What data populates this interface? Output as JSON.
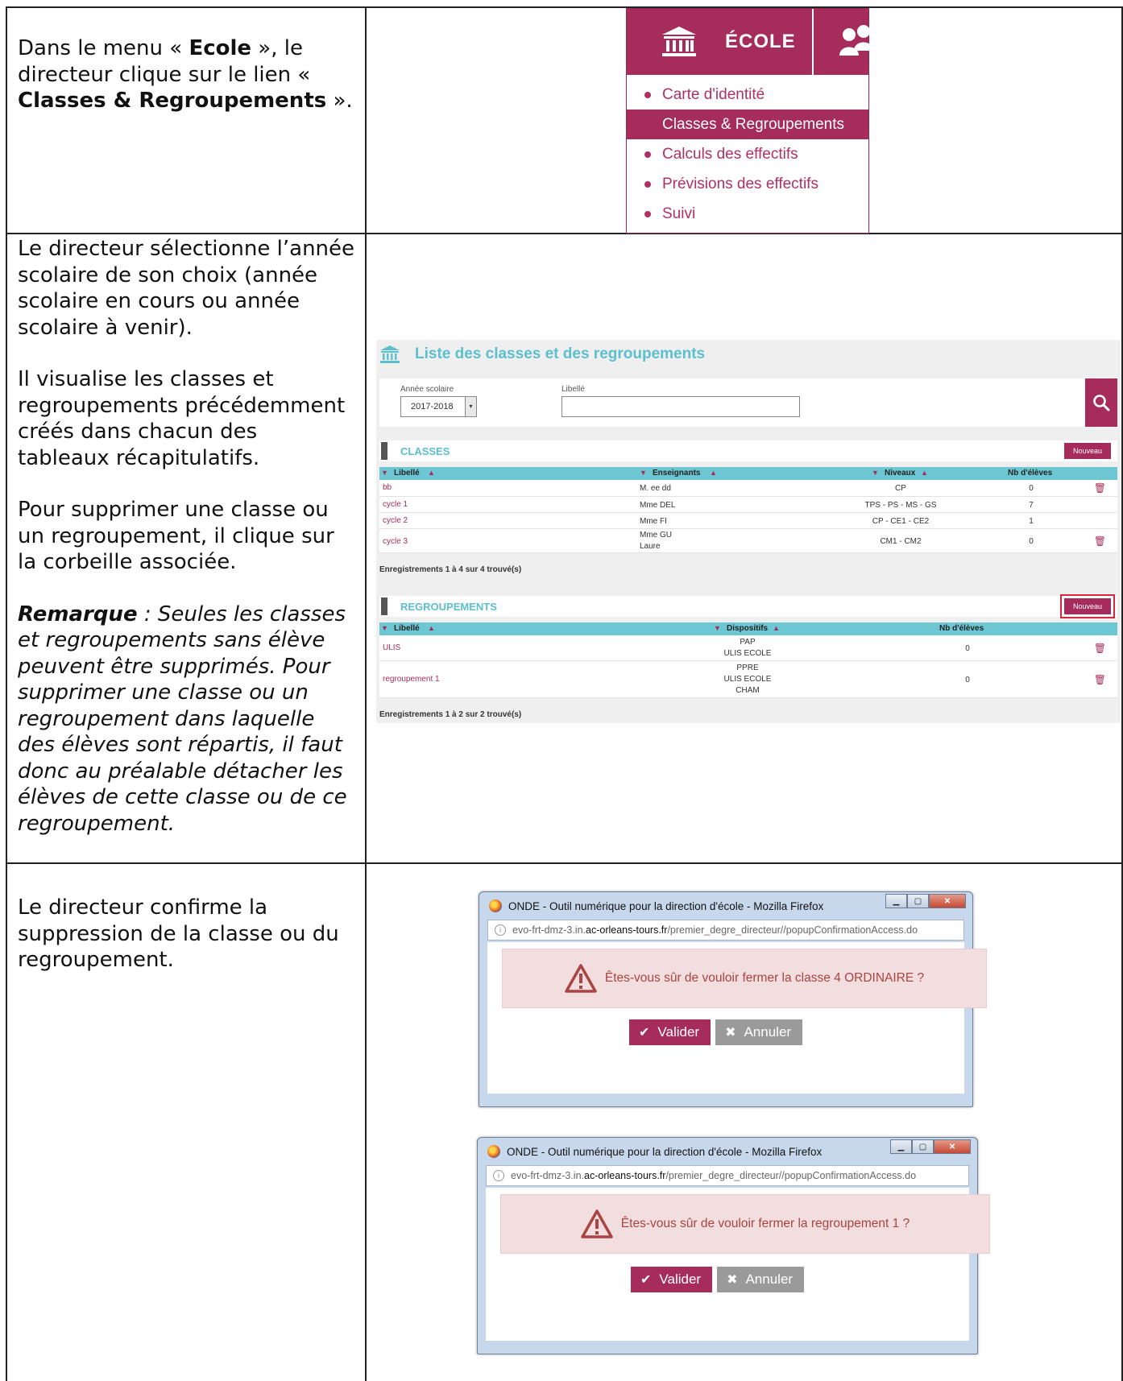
{
  "steps": [
    {
      "text_parts": [
        "Dans le menu « ",
        "Ecole",
        " », le directeur clique sur le lien « ",
        "Classes & Regroupements",
        " »."
      ]
    },
    {
      "p1": "Le directeur sélectionne l’année scolaire de son choix (année scolaire en cours ou année scolaire à venir).",
      "p2": "Il visualise les classes et regroupements précédemment créés dans chacun des tableaux récapitulatifs.",
      "p3": "Pour supprimer une classe ou un regroupement, il clique sur la corbeille associée.",
      "remark_label": "Remarque",
      "remark_text": " : Seules les classes et regroupements sans élève peuvent être supprimés. Pour supprimer une classe ou un regroupement dans laquelle des élèves sont répartis, il faut donc au préalable détacher les élèves de cette classe ou de ce regroupement."
    },
    {
      "text": "Le directeur confirme la suppression de la classe ou du regroupement."
    }
  ],
  "menu": {
    "title": "ÉCOLE",
    "items": [
      {
        "label": "Carte d'identité",
        "active": false
      },
      {
        "label": "Classes & Regroupements",
        "active": true
      },
      {
        "label": "Calculs des effectifs",
        "active": false
      },
      {
        "label": "Prévisions des effectifs",
        "active": false
      },
      {
        "label": "Suivi",
        "active": false
      }
    ]
  },
  "liste": {
    "title": "Liste des classes et des regroupements",
    "filters": {
      "year_label": "Année scolaire",
      "year_value": "2017-2018",
      "libelle_label": "Libellé",
      "libelle_value": ""
    },
    "classes": {
      "section": "CLASSES",
      "new_button": "Nouveau",
      "headers": [
        "Libellé",
        "Enseignants",
        "Niveaux",
        "Nb d'élèves"
      ],
      "rows": [
        {
          "libelle": "bb",
          "enseignants": [
            "M. ee dd"
          ],
          "niveaux": "CP",
          "nb": "0",
          "trash": true
        },
        {
          "libelle": "cycle 1",
          "enseignants": [
            "Mme DEL"
          ],
          "niveaux": "TPS - PS - MS - GS",
          "nb": "7",
          "trash": false
        },
        {
          "libelle": "cycle 2",
          "enseignants": [
            "Mme FI"
          ],
          "niveaux": "CP - CE1 - CE2",
          "nb": "1",
          "trash": false
        },
        {
          "libelle": "cycle 3",
          "enseignants": [
            "Mme GU",
            "Laure"
          ],
          "niveaux": "CM1 - CM2",
          "nb": "0",
          "trash": true
        }
      ],
      "count": "Enregistrements 1 à 4 sur 4 trouvé(s)"
    },
    "regroupements": {
      "section": "REGROUPEMENTS",
      "new_button": "Nouveau",
      "headers": [
        "Libellé",
        "Dispositifs",
        "Nb d'élèves"
      ],
      "rows": [
        {
          "libelle": "ULIS",
          "dispositifs": [
            "PAP",
            "ULIS ECOLE"
          ],
          "nb": "0",
          "trash": true
        },
        {
          "libelle": "regroupement 1",
          "dispositifs": [
            "PPRE",
            "ULIS ECOLE",
            "CHAM"
          ],
          "nb": "0",
          "trash": true
        }
      ],
      "count": "Enregistrements 1 à 2 sur 2 trouvé(s)"
    }
  },
  "dialogs": [
    {
      "window_title": "ONDE - Outil numérique pour la direction d'école - Mozilla Firefox",
      "url_prefix": "evo-frt-dmz-3.in.",
      "url_domain": "ac-orleans-tours.fr",
      "url_path": "/premier_degre_directeur//popupConfirmationAccess.do",
      "message": "Êtes-vous sûr de vouloir fermer la classe 4 ORDINAIRE ?",
      "ok": "Valider",
      "cancel": "Annuler"
    },
    {
      "window_title": "ONDE - Outil numérique pour la direction d'école - Mozilla Firefox",
      "url_prefix": "evo-frt-dmz-3.in.",
      "url_domain": "ac-orleans-tours.fr",
      "url_path": "/premier_degre_directeur//popupConfirmationAccess.do",
      "message": "Êtes-vous sûr de vouloir fermer la regroupement 1 ?",
      "ok": "Valider",
      "cancel": "Annuler"
    }
  ],
  "colors": {
    "brand": "#a62d5b",
    "accent": "#5cbfcf",
    "table_header": "#6cc7d3",
    "alert_bg": "#f2dede",
    "alert_text": "#a94442"
  }
}
